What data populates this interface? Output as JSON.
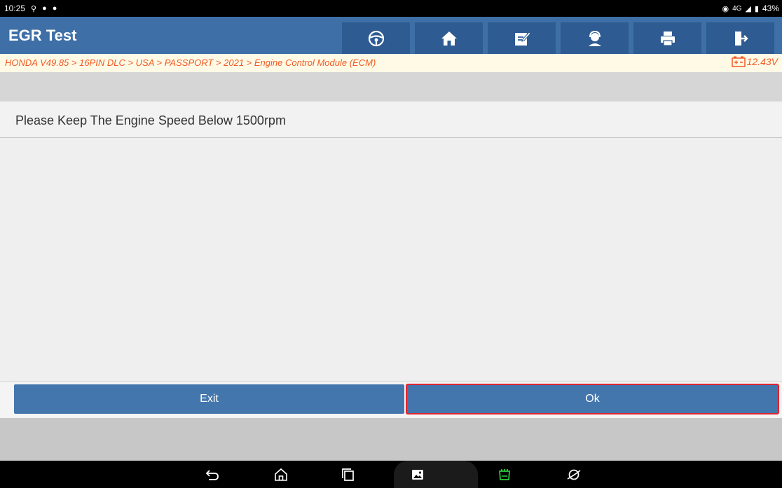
{
  "status": {
    "time": "10:25",
    "network": "4G",
    "battery": "43%"
  },
  "header": {
    "title": "EGR Test",
    "toolbar_icons": [
      "steering-wheel-icon",
      "home-icon",
      "edit-report-icon",
      "support-agent-icon",
      "print-icon",
      "exit-door-icon"
    ]
  },
  "breadcrumb": {
    "path": "HONDA V49.85 > 16PIN DLC > USA > PASSPORT > 2021 > Engine Control Module (ECM)",
    "voltage": "12.43V"
  },
  "message": {
    "text": "Please Keep The Engine Speed Below 1500rpm"
  },
  "actions": {
    "exit_label": "Exit",
    "ok_label": "Ok"
  },
  "colors": {
    "header_bg": "#3e6fa6",
    "button_bg": "#4376ad",
    "breadcrumb_text": "#f15a24",
    "highlight": "#e0242f"
  }
}
